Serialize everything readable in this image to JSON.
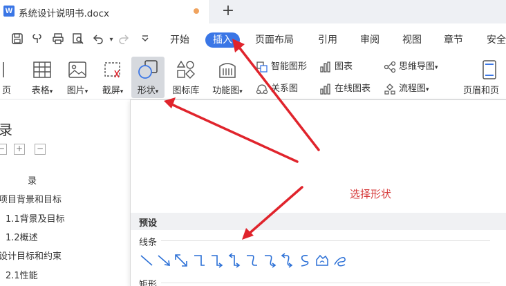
{
  "titlebar": {
    "doc_icon_letter": "W",
    "doc_title": "系统设计说明书.docx",
    "new_tab_symbol": "+"
  },
  "menu": {
    "items": [
      "开始",
      "插入",
      "页面布局",
      "引用",
      "审阅",
      "视图",
      "章节",
      "安全"
    ],
    "active": "插入"
  },
  "ribbon": {
    "left_cut_label": "页",
    "buttons": [
      {
        "label": "表格",
        "icon": "table-icon"
      },
      {
        "label": "图片",
        "icon": "picture-icon"
      },
      {
        "label": "截屏",
        "icon": "screenshot-icon"
      },
      {
        "label": "形状",
        "icon": "shapes-icon"
      },
      {
        "label": "图标库",
        "icon": "icon-library-icon"
      },
      {
        "label": "功能图",
        "icon": "function-chart-icon"
      },
      {
        "label": "页眉和页",
        "icon": "header-footer-icon"
      }
    ],
    "small_buttons": [
      {
        "label": "智能图形",
        "icon": "smart-graphic-icon"
      },
      {
        "label": "图表",
        "icon": "chart-icon"
      },
      {
        "label": "思维导图",
        "icon": "mind-map-icon"
      },
      {
        "label": "关系图",
        "icon": "relationship-icon"
      },
      {
        "label": "在线图表",
        "icon": "online-chart-icon"
      },
      {
        "label": "流程图",
        "icon": "flowchart-icon"
      }
    ]
  },
  "document": {
    "toc_heading": "录",
    "toc_title": "录",
    "toc_controls": [
      "−",
      "+",
      "−"
    ],
    "toc_items": [
      "项目背景和目标",
      "1.1背景及目标",
      "1.2概述",
      "设计目标和约束",
      "2.1性能"
    ]
  },
  "shapes_panel": {
    "preset_label": "预设",
    "sections": [
      "线条",
      "矩形"
    ],
    "line_shapes": [
      "line",
      "arrow",
      "double-arrow",
      "elbow-connector",
      "elbow-arrow",
      "elbow-double-arrow",
      "curved-connector",
      "curved-arrow",
      "curved-double-arrow",
      "curve",
      "freeform",
      "scribble"
    ]
  },
  "annotation": {
    "text": "选择形状",
    "color": "#d63a3a"
  },
  "colors": {
    "accent": "#3a76e6",
    "annotation_red": "#e0242c",
    "selected_bg": "#d6d9de"
  }
}
